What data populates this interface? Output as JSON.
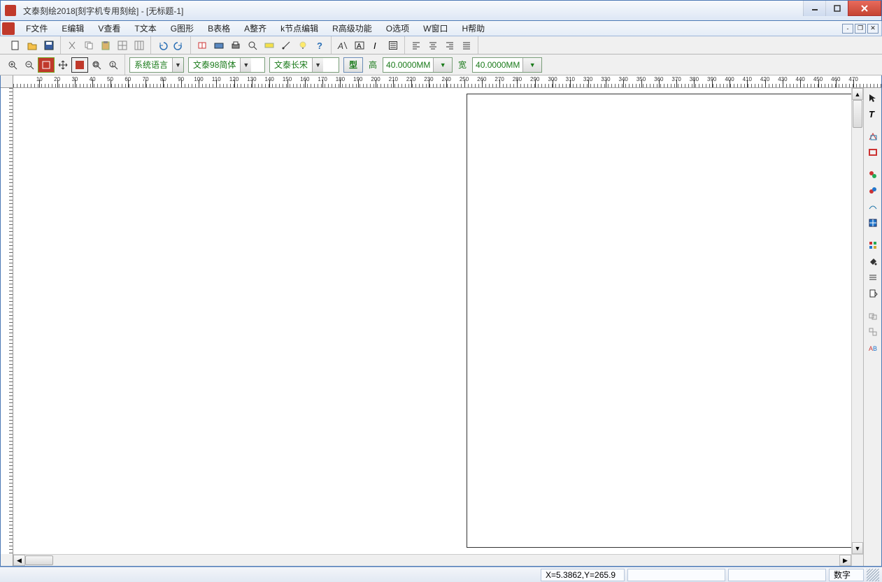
{
  "title": "文泰刻绘2018[刻字机专用刻绘] - [无标题-1]",
  "menu": [
    "F文件",
    "E编辑",
    "V查看",
    "T文本",
    "G图形",
    "B表格",
    "A整齐",
    "k节点编辑",
    "R高级功能",
    "O选项",
    "W窗口",
    "H帮助"
  ],
  "fontbar": {
    "lang": "系统语言",
    "font_family": "文泰98简体",
    "font_style": "文泰长宋",
    "type_btn": "型",
    "height_label": "高",
    "height_value": "40.0000MM",
    "width_label": "宽",
    "width_value": "40.0000MM"
  },
  "ruler_x_labels": [
    "10",
    "20",
    "30",
    "40",
    "50",
    "60",
    "70",
    "80",
    "90",
    "100",
    "110",
    "120",
    "130",
    "140",
    "150",
    "160",
    "170",
    "180",
    "190",
    "200",
    "210",
    "220",
    "230",
    "240",
    "250",
    "260",
    "270",
    "280",
    "290",
    "300",
    "310",
    "320",
    "330",
    "340",
    "350",
    "360",
    "370",
    "380",
    "390",
    "400",
    "410",
    "420",
    "430",
    "440",
    "450",
    "460",
    "470"
  ],
  "status": {
    "coords": "X=5.3862,Y=265.9",
    "mode": "数字"
  }
}
